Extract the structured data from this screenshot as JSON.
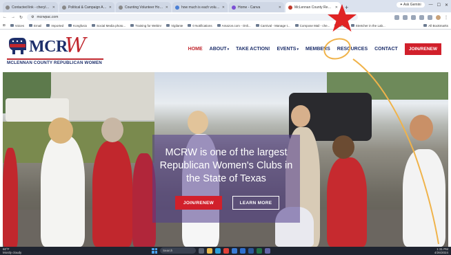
{
  "browser": {
    "tabs": [
      {
        "label": "Contacted link - cherylerranm...",
        "icon": "mail-icon",
        "color": "#888888",
        "active": false
      },
      {
        "label": "Political & Campaign Activities",
        "icon": "globe-icon",
        "color": "#888888",
        "active": false
      },
      {
        "label": "Counting Volunteer Hours | Vo...",
        "icon": "doc-icon",
        "color": "#888888",
        "active": false
      },
      {
        "label": "how much is each volunteer h...",
        "icon": "google-icon",
        "color": "#4a7fd4",
        "active": false
      },
      {
        "label": "Home - Canva",
        "icon": "canva-icon",
        "color": "#7b4fd4",
        "active": false
      },
      {
        "label": "McLennan County Republican...",
        "icon": "mcrw-icon",
        "color": "#c0392b",
        "active": true
      }
    ],
    "new_tab": "+",
    "ask_gemini": "Ask Gemini",
    "url": "mcrwpac.com",
    "bookmarks": [
      "Voices",
      "Email",
      "Imported",
      "Kongfusio",
      "Social Media photo...",
      "Training for Webinr",
      "Vigilante",
      "0 Notifications",
      "Amazon.com - Onli...",
      "Carnival - Manage t...",
      "Compose Mail - che...",
      "Strip",
      "Stretcher in the Lab..."
    ],
    "all_bookmarks": "All Bookmarks"
  },
  "site": {
    "logo_text": "MCR",
    "logo_script": "W",
    "logo_subtitle": "MCLENNAN COUNTY REPUBLICAN WOMEN",
    "nav": {
      "home": "HOME",
      "about": "ABOUT",
      "take_action": "TAKE ACTION!",
      "events": "EVENTS",
      "members": "MEMBERS",
      "resources": "RESOURCES",
      "contact": "CONTACT",
      "join": "JOIN/RENEW"
    },
    "hero": {
      "headline": "MCRW is one of the largest Republican Women's Clubs in the State of Texas",
      "join_button": "JOIN/RENEW",
      "learn_button": "LEARN MORE"
    }
  },
  "taskbar": {
    "weather_temp": "60°F",
    "weather_desc": "Mostly cloudy",
    "search_placeholder": "Search",
    "time": "1:31 PM",
    "date": "4/26/2024"
  },
  "colors": {
    "brand_red": "#d1202b",
    "brand_navy": "#1d2f6b",
    "annotation_star": "#e02424",
    "annotation_circle": "#f0b34a"
  }
}
